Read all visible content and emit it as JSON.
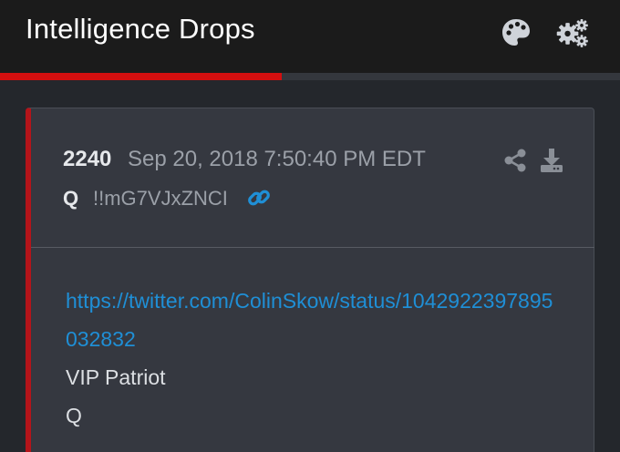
{
  "header": {
    "title": "Intelligence Drops",
    "icons": [
      "palette-icon",
      "gears-icon"
    ]
  },
  "progress": {
    "fraction": 0.455,
    "color": "#d40f0f"
  },
  "post": {
    "number": "2240",
    "date": "Sep 20, 2018 7:50:40 PM EDT",
    "author": "Q",
    "tripcode": "!!mG7VJxZNCI",
    "icons": [
      "link-icon",
      "share-icon",
      "download-icon"
    ],
    "link": "https://twitter.com/ColinSkow/status/1042922397895032832",
    "lines": [
      "VIP Patriot",
      "Q"
    ],
    "accent_color": "#b4141a",
    "link_color": "#1f8fd6"
  }
}
